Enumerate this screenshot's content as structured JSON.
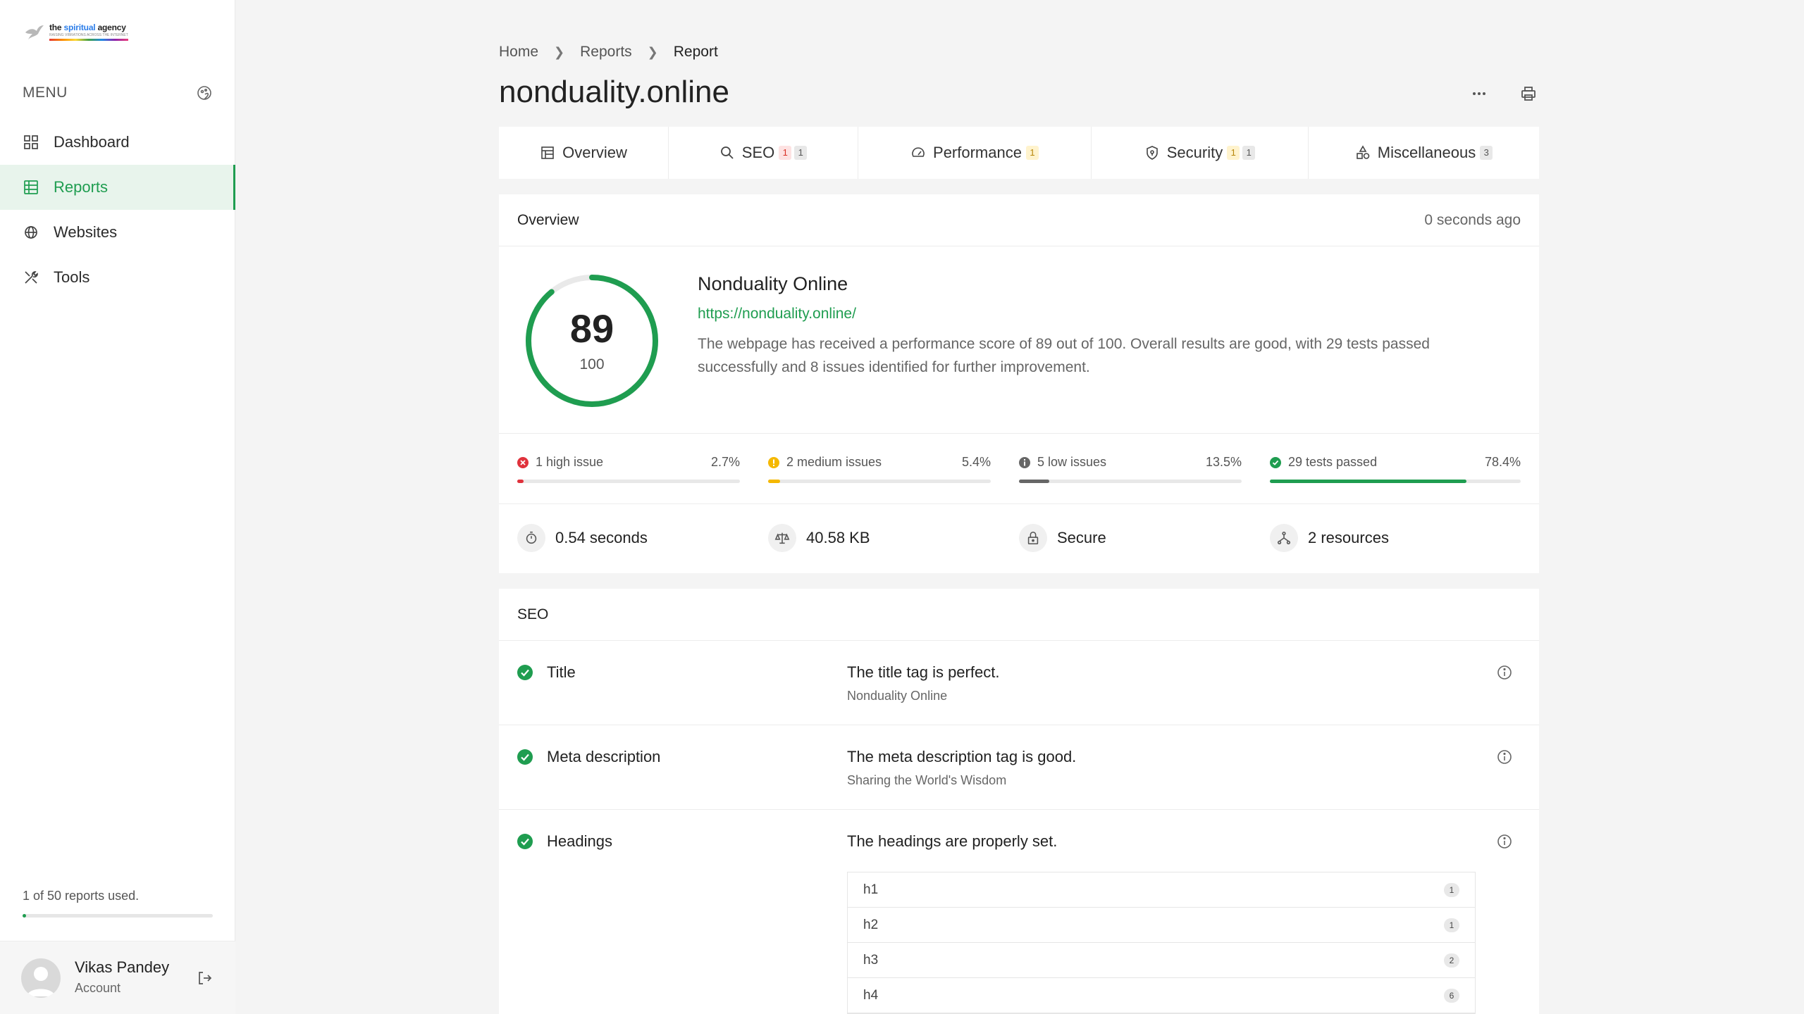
{
  "brand": {
    "name_prefix": "the ",
    "name_highlight": "spiritual",
    "name_suffix": " agency",
    "tagline": "RAISING VIBRATIONS ACROSS THE INTERNET"
  },
  "sidebar": {
    "menu_title": "MENU",
    "items": [
      {
        "label": "Dashboard",
        "icon": "dashboard-icon"
      },
      {
        "label": "Reports",
        "icon": "reports-icon",
        "active": true
      },
      {
        "label": "Websites",
        "icon": "globe-icon"
      },
      {
        "label": "Tools",
        "icon": "tools-icon"
      }
    ],
    "usage_text": "1 of 50 reports used.",
    "usage_fraction": 0.02,
    "account_name": "Vikas Pandey",
    "account_sub": "Account"
  },
  "breadcrumb": [
    "Home",
    "Reports",
    "Report"
  ],
  "page_title": "nonduality.online",
  "tabs": [
    {
      "label": "Overview",
      "icon": "overview-icon",
      "badges": []
    },
    {
      "label": "SEO",
      "icon": "search-icon",
      "badges": [
        {
          "text": "1",
          "kind": "red"
        },
        {
          "text": "1",
          "kind": "gray"
        }
      ]
    },
    {
      "label": "Performance",
      "icon": "gauge-icon",
      "badges": [
        {
          "text": "1",
          "kind": "yellow"
        }
      ]
    },
    {
      "label": "Security",
      "icon": "shield-icon",
      "badges": [
        {
          "text": "1",
          "kind": "yellow"
        },
        {
          "text": "1",
          "kind": "gray"
        }
      ]
    },
    {
      "label": "Miscellaneous",
      "icon": "shapes-icon",
      "badges": [
        {
          "text": "3",
          "kind": "gray"
        }
      ]
    }
  ],
  "overview": {
    "header": "Overview",
    "time_ago": "0 seconds ago",
    "score": "89",
    "score_max": "100",
    "site_title": "Nonduality Online",
    "url": "https://nonduality.online/",
    "description": "The webpage has received a performance score of 89 out of 100. Overall results are good, with 29 tests passed successfully and 8 issues identified for further improvement.",
    "issues": [
      {
        "label": "1 high issue",
        "percent": "2.7%",
        "fraction": 0.027,
        "color": "#e0323c"
      },
      {
        "label": "2 medium issues",
        "percent": "5.4%",
        "fraction": 0.054,
        "color": "#f5b800"
      },
      {
        "label": "5 low issues",
        "percent": "13.5%",
        "fraction": 0.135,
        "color": "#666666"
      },
      {
        "label": "29 tests passed",
        "percent": "78.4%",
        "fraction": 0.784,
        "color": "#1f9d50"
      }
    ],
    "stats": [
      {
        "value": "0.54 seconds",
        "icon": "stopwatch-icon"
      },
      {
        "value": "40.58 KB",
        "icon": "scale-icon"
      },
      {
        "value": "Secure",
        "icon": "lock-icon"
      },
      {
        "value": "2 resources",
        "icon": "network-icon"
      }
    ]
  },
  "seo": {
    "header": "SEO",
    "rows": [
      {
        "name": "Title",
        "message": "The title tag is perfect.",
        "detail": "Nonduality Online"
      },
      {
        "name": "Meta description",
        "message": "The meta description tag is good.",
        "detail": "Sharing the World's Wisdom"
      },
      {
        "name": "Headings",
        "message": "The headings are properly set.",
        "detail": ""
      }
    ],
    "headings": [
      {
        "tag": "h1",
        "count": "1"
      },
      {
        "tag": "h2",
        "count": "1"
      },
      {
        "tag": "h3",
        "count": "2"
      },
      {
        "tag": "h4",
        "count": "6"
      }
    ]
  },
  "colors": {
    "accent": "#1f9d50",
    "high": "#e0323c",
    "medium": "#f5b800",
    "low": "#666666"
  }
}
